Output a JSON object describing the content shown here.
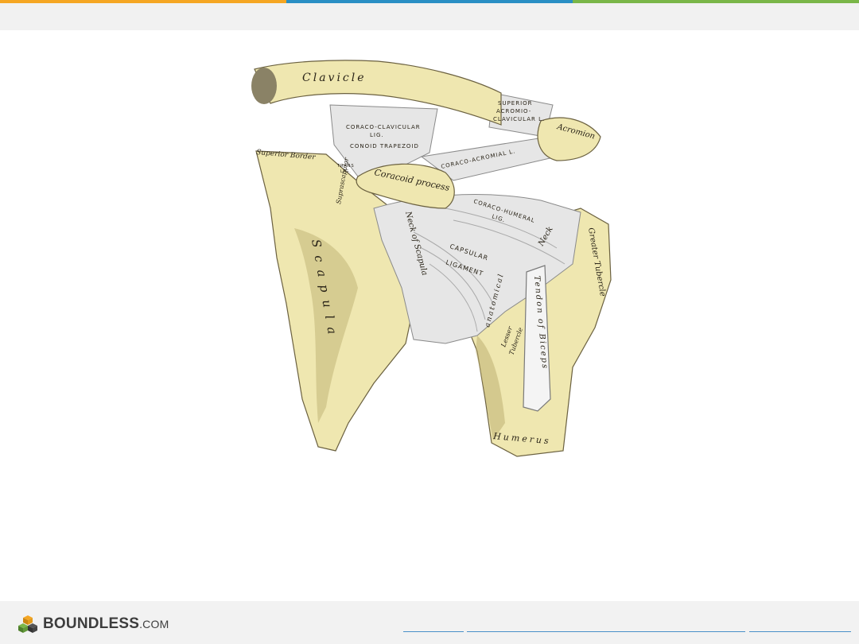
{
  "colors": {
    "stripe_orange": "#f5a623",
    "stripe_blue": "#2a8fc4",
    "stripe_green": "#7ab648",
    "bone": "#efe7b0",
    "bone_shadow": "#b9ab6c",
    "ligament": "#e6e6e6",
    "ink": "#2a2418"
  },
  "figure": {
    "labels": {
      "clavicle": "Clavicle",
      "superior_acromio_clavicular": [
        "SUPERIOR",
        "ACROMIO-",
        "CLAVICULAR L."
      ],
      "acromion": "Acromion",
      "coraco_clavicular_lig": [
        "CORACO-CLAVICULAR",
        "LIG."
      ],
      "conoid_trapezoid": "CONOID   TRAPEZOID",
      "coraco_acromial": "CORACO-ACROMIAL L.",
      "superior_border": "Superior Border",
      "suprascapular": "Suprascapular",
      "transverse_lig": [
        "TRANS",
        "LIG."
      ],
      "coracoid_process": "Coracoid process",
      "coraco_humeral_lig": [
        "CORACO-HUMERAL",
        "LIG."
      ],
      "neck_of_scapula": "Neck of Scapula",
      "neck": "Neck",
      "greater_tubercle": "Greater Tubercle",
      "scapula": "Scapula",
      "capsular_ligament": [
        "CAPSULAR",
        "LIGAMENT"
      ],
      "anatomical": "anatomical",
      "tendon_of_biceps": "Tendon of Biceps",
      "lesser_tubercle": [
        "Lesser",
        "Tubercle"
      ],
      "humerus": "Humerus"
    }
  },
  "footer": {
    "logo_main": "BOUNDLESS",
    "logo_suffix": ".COM",
    "logo_icon": "cube-stack-icon"
  }
}
